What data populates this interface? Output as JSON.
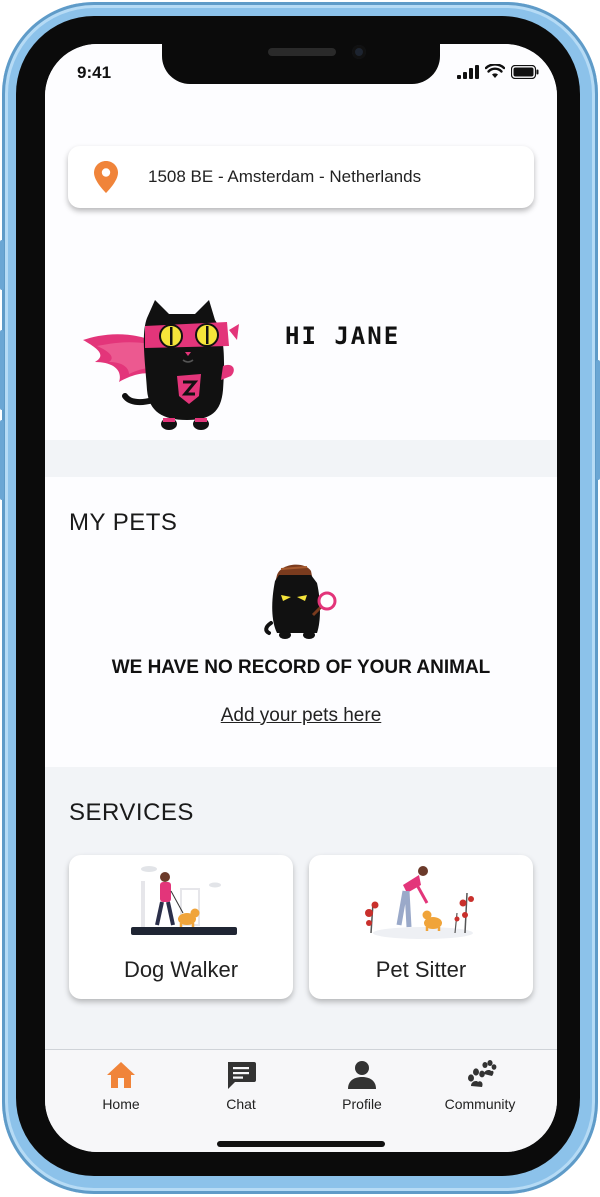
{
  "status_bar": {
    "time": "9:41"
  },
  "location": {
    "text": "1508 BE - Amsterdam - Netherlands",
    "icon": "location-pin-icon"
  },
  "greeting": {
    "text": "HI JANE"
  },
  "pets": {
    "title": "MY PETS",
    "empty_message": "WE HAVE NO RECORD OF YOUR ANIMAL",
    "add_link": "Add your pets here"
  },
  "services": {
    "title": "SERVICES",
    "items": [
      {
        "label": "Dog Walker"
      },
      {
        "label": "Pet Sitter"
      }
    ]
  },
  "bottom_nav": {
    "items": [
      {
        "label": "Home",
        "icon": "home-icon",
        "active": true
      },
      {
        "label": "Chat",
        "icon": "chat-icon",
        "active": false
      },
      {
        "label": "Profile",
        "icon": "profile-icon",
        "active": false
      },
      {
        "label": "Community",
        "icon": "paw-icon",
        "active": false
      }
    ]
  },
  "colors": {
    "accent": "#f0843a",
    "brand_pink": "#e3357a",
    "text": "#222222",
    "section_bg": "#f2f4f7"
  }
}
